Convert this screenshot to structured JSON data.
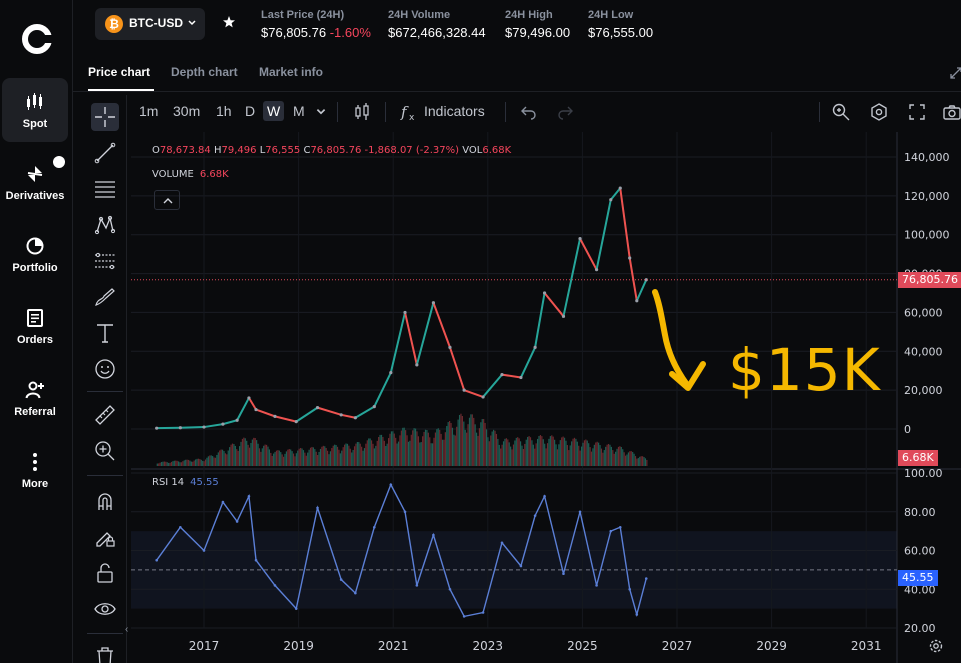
{
  "nav": {
    "items": [
      {
        "label": "Spot",
        "icon": "candles-icon",
        "active": true
      },
      {
        "label": "Derivatives",
        "icon": "derivatives-icon"
      },
      {
        "label": "Portfolio",
        "icon": "pie-icon"
      },
      {
        "label": "Orders",
        "icon": "orders-icon"
      },
      {
        "label": "Referral",
        "icon": "add-user-icon"
      },
      {
        "label": "More",
        "icon": "more-icon"
      }
    ]
  },
  "header": {
    "pair": "BTC-USD",
    "btc_symbol": "₿",
    "stats": [
      {
        "label": "Last Price (24H)",
        "value": "$76,805.76",
        "change": "-1.60%"
      },
      {
        "label": "24H Volume",
        "value": "$672,466,328.44"
      },
      {
        "label": "24H High",
        "value": "$79,496.00"
      },
      {
        "label": "24H Low",
        "value": "$76,555.00"
      }
    ]
  },
  "tabs": [
    "Price chart",
    "Depth chart",
    "Market info"
  ],
  "toolbar": {
    "timeframes": [
      "1m",
      "30m",
      "1h",
      "D",
      "W",
      "M"
    ],
    "active_timeframe": "W",
    "indicators_label": "Indicators"
  },
  "legend": {
    "o_key": "O",
    "o": "78,673.84",
    "h_key": "H",
    "h": "79,496",
    "l_key": "L",
    "l": "76,555",
    "c_key": "C",
    "c": "76,805.76",
    "change": "-1,868.07 (-2.37%)",
    "vol_key": "VOL",
    "vol": "6.68K",
    "volume_label": "VOLUME",
    "volume_value": "6.68K",
    "rsi_label": "RSI 14",
    "rsi_value": "45.55"
  },
  "price_tag": "76,805.76",
  "volume_tag": "6.68K",
  "rsi_tag": "45.55",
  "annotation": "$15K",
  "colors": {
    "up": "#26a69a",
    "down": "#ef5350",
    "rsi": "#5b7fd6",
    "annotation": "#f5b800",
    "accent": "#2962ff"
  },
  "chart_data": {
    "type": "line",
    "price_axis": {
      "ticks": [
        "140,000",
        "120,000",
        "100,000",
        "80,000",
        "60,000",
        "40,000",
        "20,000",
        "0"
      ],
      "ylim": [
        0,
        140000
      ]
    },
    "rsi_axis": {
      "ticks": [
        "100.00",
        "80.00",
        "60.00",
        "40.00",
        "20.00"
      ],
      "ylim": [
        20,
        100
      ]
    },
    "x_ticks": [
      "2017",
      "2019",
      "2021",
      "2023",
      "2025",
      "2027",
      "2029",
      "2031"
    ],
    "price_series": [
      {
        "x": 2016.0,
        "y": 430
      },
      {
        "x": 2016.5,
        "y": 650
      },
      {
        "x": 2017.0,
        "y": 1000
      },
      {
        "x": 2017.4,
        "y": 2500
      },
      {
        "x": 2017.7,
        "y": 4500
      },
      {
        "x": 2017.95,
        "y": 16000
      },
      {
        "x": 2018.1,
        "y": 10000
      },
      {
        "x": 2018.5,
        "y": 6500
      },
      {
        "x": 2018.95,
        "y": 3800
      },
      {
        "x": 2019.4,
        "y": 11000
      },
      {
        "x": 2019.9,
        "y": 7300
      },
      {
        "x": 2020.2,
        "y": 5800
      },
      {
        "x": 2020.6,
        "y": 11500
      },
      {
        "x": 2020.95,
        "y": 29000
      },
      {
        "x": 2021.25,
        "y": 60000
      },
      {
        "x": 2021.5,
        "y": 33000
      },
      {
        "x": 2021.85,
        "y": 65000
      },
      {
        "x": 2022.2,
        "y": 42000
      },
      {
        "x": 2022.5,
        "y": 20000
      },
      {
        "x": 2022.9,
        "y": 16500
      },
      {
        "x": 2023.3,
        "y": 28000
      },
      {
        "x": 2023.7,
        "y": 26500
      },
      {
        "x": 2024.0,
        "y": 42000
      },
      {
        "x": 2024.2,
        "y": 70000
      },
      {
        "x": 2024.6,
        "y": 58000
      },
      {
        "x": 2024.95,
        "y": 98000
      },
      {
        "x": 2025.3,
        "y": 82000
      },
      {
        "x": 2025.6,
        "y": 118000
      },
      {
        "x": 2025.8,
        "y": 124000
      },
      {
        "x": 2026.0,
        "y": 88000
      },
      {
        "x": 2026.15,
        "y": 66000
      },
      {
        "x": 2026.35,
        "y": 76805
      }
    ],
    "rsi_series": [
      {
        "x": 2016.0,
        "y": 55
      },
      {
        "x": 2016.5,
        "y": 72
      },
      {
        "x": 2017.0,
        "y": 60
      },
      {
        "x": 2017.4,
        "y": 85
      },
      {
        "x": 2017.7,
        "y": 75
      },
      {
        "x": 2017.95,
        "y": 88
      },
      {
        "x": 2018.1,
        "y": 55
      },
      {
        "x": 2018.5,
        "y": 42
      },
      {
        "x": 2018.95,
        "y": 30
      },
      {
        "x": 2019.4,
        "y": 82
      },
      {
        "x": 2019.9,
        "y": 45
      },
      {
        "x": 2020.2,
        "y": 38
      },
      {
        "x": 2020.6,
        "y": 72
      },
      {
        "x": 2020.95,
        "y": 94
      },
      {
        "x": 2021.25,
        "y": 80
      },
      {
        "x": 2021.5,
        "y": 42
      },
      {
        "x": 2021.85,
        "y": 68
      },
      {
        "x": 2022.2,
        "y": 40
      },
      {
        "x": 2022.5,
        "y": 26
      },
      {
        "x": 2022.9,
        "y": 28
      },
      {
        "x": 2023.3,
        "y": 64
      },
      {
        "x": 2023.7,
        "y": 52
      },
      {
        "x": 2024.0,
        "y": 78
      },
      {
        "x": 2024.2,
        "y": 88
      },
      {
        "x": 2024.6,
        "y": 48
      },
      {
        "x": 2024.95,
        "y": 80
      },
      {
        "x": 2025.3,
        "y": 42
      },
      {
        "x": 2025.6,
        "y": 70
      },
      {
        "x": 2025.8,
        "y": 72
      },
      {
        "x": 2026.0,
        "y": 40
      },
      {
        "x": 2026.15,
        "y": 27
      },
      {
        "x": 2026.35,
        "y": 45.55
      }
    ],
    "volume_series": [
      {
        "x": 2016.0,
        "y": 1
      },
      {
        "x": 2017.0,
        "y": 2
      },
      {
        "x": 2017.95,
        "y": 8
      },
      {
        "x": 2018.5,
        "y": 4
      },
      {
        "x": 2019.4,
        "y": 5
      },
      {
        "x": 2020.2,
        "y": 6
      },
      {
        "x": 2021.25,
        "y": 10
      },
      {
        "x": 2021.85,
        "y": 9
      },
      {
        "x": 2022.5,
        "y": 14
      },
      {
        "x": 2022.9,
        "y": 12
      },
      {
        "x": 2023.3,
        "y": 7
      },
      {
        "x": 2024.2,
        "y": 8
      },
      {
        "x": 2024.95,
        "y": 7
      },
      {
        "x": 2025.8,
        "y": 5
      },
      {
        "x": 2026.35,
        "y": 2
      }
    ],
    "last_price": 76805.76
  }
}
